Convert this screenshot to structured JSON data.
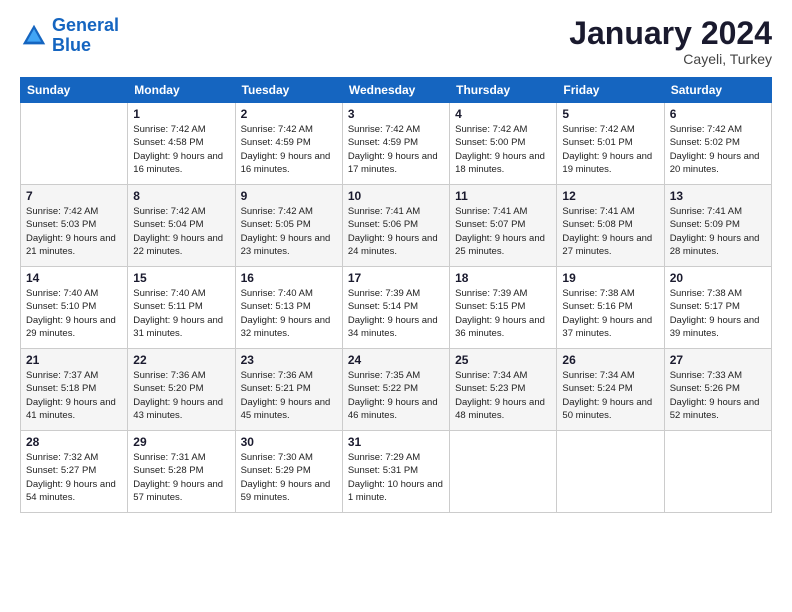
{
  "header": {
    "logo_line1": "General",
    "logo_line2": "Blue",
    "month": "January 2024",
    "location": "Cayeli, Turkey"
  },
  "columns": [
    "Sunday",
    "Monday",
    "Tuesday",
    "Wednesday",
    "Thursday",
    "Friday",
    "Saturday"
  ],
  "weeks": [
    [
      {
        "day": "",
        "sunrise": "",
        "sunset": "",
        "daylight": ""
      },
      {
        "day": "1",
        "sunrise": "Sunrise: 7:42 AM",
        "sunset": "Sunset: 4:58 PM",
        "daylight": "Daylight: 9 hours and 16 minutes."
      },
      {
        "day": "2",
        "sunrise": "Sunrise: 7:42 AM",
        "sunset": "Sunset: 4:59 PM",
        "daylight": "Daylight: 9 hours and 16 minutes."
      },
      {
        "day": "3",
        "sunrise": "Sunrise: 7:42 AM",
        "sunset": "Sunset: 4:59 PM",
        "daylight": "Daylight: 9 hours and 17 minutes."
      },
      {
        "day": "4",
        "sunrise": "Sunrise: 7:42 AM",
        "sunset": "Sunset: 5:00 PM",
        "daylight": "Daylight: 9 hours and 18 minutes."
      },
      {
        "day": "5",
        "sunrise": "Sunrise: 7:42 AM",
        "sunset": "Sunset: 5:01 PM",
        "daylight": "Daylight: 9 hours and 19 minutes."
      },
      {
        "day": "6",
        "sunrise": "Sunrise: 7:42 AM",
        "sunset": "Sunset: 5:02 PM",
        "daylight": "Daylight: 9 hours and 20 minutes."
      }
    ],
    [
      {
        "day": "7",
        "sunrise": "Sunrise: 7:42 AM",
        "sunset": "Sunset: 5:03 PM",
        "daylight": "Daylight: 9 hours and 21 minutes."
      },
      {
        "day": "8",
        "sunrise": "Sunrise: 7:42 AM",
        "sunset": "Sunset: 5:04 PM",
        "daylight": "Daylight: 9 hours and 22 minutes."
      },
      {
        "day": "9",
        "sunrise": "Sunrise: 7:42 AM",
        "sunset": "Sunset: 5:05 PM",
        "daylight": "Daylight: 9 hours and 23 minutes."
      },
      {
        "day": "10",
        "sunrise": "Sunrise: 7:41 AM",
        "sunset": "Sunset: 5:06 PM",
        "daylight": "Daylight: 9 hours and 24 minutes."
      },
      {
        "day": "11",
        "sunrise": "Sunrise: 7:41 AM",
        "sunset": "Sunset: 5:07 PM",
        "daylight": "Daylight: 9 hours and 25 minutes."
      },
      {
        "day": "12",
        "sunrise": "Sunrise: 7:41 AM",
        "sunset": "Sunset: 5:08 PM",
        "daylight": "Daylight: 9 hours and 27 minutes."
      },
      {
        "day": "13",
        "sunrise": "Sunrise: 7:41 AM",
        "sunset": "Sunset: 5:09 PM",
        "daylight": "Daylight: 9 hours and 28 minutes."
      }
    ],
    [
      {
        "day": "14",
        "sunrise": "Sunrise: 7:40 AM",
        "sunset": "Sunset: 5:10 PM",
        "daylight": "Daylight: 9 hours and 29 minutes."
      },
      {
        "day": "15",
        "sunrise": "Sunrise: 7:40 AM",
        "sunset": "Sunset: 5:11 PM",
        "daylight": "Daylight: 9 hours and 31 minutes."
      },
      {
        "day": "16",
        "sunrise": "Sunrise: 7:40 AM",
        "sunset": "Sunset: 5:13 PM",
        "daylight": "Daylight: 9 hours and 32 minutes."
      },
      {
        "day": "17",
        "sunrise": "Sunrise: 7:39 AM",
        "sunset": "Sunset: 5:14 PM",
        "daylight": "Daylight: 9 hours and 34 minutes."
      },
      {
        "day": "18",
        "sunrise": "Sunrise: 7:39 AM",
        "sunset": "Sunset: 5:15 PM",
        "daylight": "Daylight: 9 hours and 36 minutes."
      },
      {
        "day": "19",
        "sunrise": "Sunrise: 7:38 AM",
        "sunset": "Sunset: 5:16 PM",
        "daylight": "Daylight: 9 hours and 37 minutes."
      },
      {
        "day": "20",
        "sunrise": "Sunrise: 7:38 AM",
        "sunset": "Sunset: 5:17 PM",
        "daylight": "Daylight: 9 hours and 39 minutes."
      }
    ],
    [
      {
        "day": "21",
        "sunrise": "Sunrise: 7:37 AM",
        "sunset": "Sunset: 5:18 PM",
        "daylight": "Daylight: 9 hours and 41 minutes."
      },
      {
        "day": "22",
        "sunrise": "Sunrise: 7:36 AM",
        "sunset": "Sunset: 5:20 PM",
        "daylight": "Daylight: 9 hours and 43 minutes."
      },
      {
        "day": "23",
        "sunrise": "Sunrise: 7:36 AM",
        "sunset": "Sunset: 5:21 PM",
        "daylight": "Daylight: 9 hours and 45 minutes."
      },
      {
        "day": "24",
        "sunrise": "Sunrise: 7:35 AM",
        "sunset": "Sunset: 5:22 PM",
        "daylight": "Daylight: 9 hours and 46 minutes."
      },
      {
        "day": "25",
        "sunrise": "Sunrise: 7:34 AM",
        "sunset": "Sunset: 5:23 PM",
        "daylight": "Daylight: 9 hours and 48 minutes."
      },
      {
        "day": "26",
        "sunrise": "Sunrise: 7:34 AM",
        "sunset": "Sunset: 5:24 PM",
        "daylight": "Daylight: 9 hours and 50 minutes."
      },
      {
        "day": "27",
        "sunrise": "Sunrise: 7:33 AM",
        "sunset": "Sunset: 5:26 PM",
        "daylight": "Daylight: 9 hours and 52 minutes."
      }
    ],
    [
      {
        "day": "28",
        "sunrise": "Sunrise: 7:32 AM",
        "sunset": "Sunset: 5:27 PM",
        "daylight": "Daylight: 9 hours and 54 minutes."
      },
      {
        "day": "29",
        "sunrise": "Sunrise: 7:31 AM",
        "sunset": "Sunset: 5:28 PM",
        "daylight": "Daylight: 9 hours and 57 minutes."
      },
      {
        "day": "30",
        "sunrise": "Sunrise: 7:30 AM",
        "sunset": "Sunset: 5:29 PM",
        "daylight": "Daylight: 9 hours and 59 minutes."
      },
      {
        "day": "31",
        "sunrise": "Sunrise: 7:29 AM",
        "sunset": "Sunset: 5:31 PM",
        "daylight": "Daylight: 10 hours and 1 minute."
      },
      {
        "day": "",
        "sunrise": "",
        "sunset": "",
        "daylight": ""
      },
      {
        "day": "",
        "sunrise": "",
        "sunset": "",
        "daylight": ""
      },
      {
        "day": "",
        "sunrise": "",
        "sunset": "",
        "daylight": ""
      }
    ]
  ]
}
